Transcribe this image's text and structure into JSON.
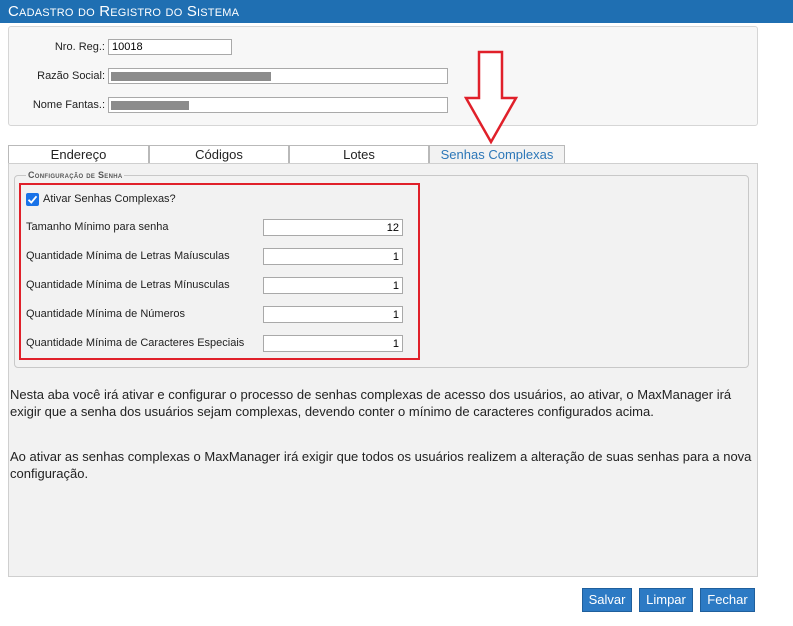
{
  "window": {
    "title": "Cadastro do Registro do Sistema"
  },
  "header": {
    "nro_reg_label": "Nro. Reg.:",
    "nro_reg_value": "10018",
    "razao_social_label": "Razão Social:",
    "nome_fantasia_label": "Nome Fantas.:"
  },
  "tabs": [
    {
      "label": "Endereço"
    },
    {
      "label": "Códigos"
    },
    {
      "label": "Lotes"
    },
    {
      "label": "Senhas Complexas",
      "active": true
    }
  ],
  "config": {
    "legend": "Configuração de Senha",
    "enable_label": "Ativar Senhas Complexas?",
    "enabled": true,
    "fields": [
      {
        "label": "Tamanho Mínimo para senha",
        "value": "12"
      },
      {
        "label": "Quantidade Mínima de Letras Maíusculas",
        "value": "1"
      },
      {
        "label": "Quantidade Mínima de Letras Mínusculas",
        "value": "1"
      },
      {
        "label": "Quantidade Mínima de Números",
        "value": "1"
      },
      {
        "label": "Quantidade Mínima de Caracteres Especiais",
        "value": "1"
      }
    ]
  },
  "info": {
    "paragraph1": "Nesta aba você irá ativar e configurar o processo de senhas complexas de acesso dos usuários, ao ativar, o MaxManager irá exigir que a senha dos usuários sejam complexas, devendo conter o mínimo de caracteres configurados acima.",
    "paragraph2": "Ao ativar as senhas complexas o MaxManager irá exigir que todos os usuários realizem a alteração de suas senhas para a nova configuração."
  },
  "buttons": {
    "salvar": "Salvar",
    "limpar": "Limpar",
    "fechar": "Fechar"
  },
  "colors": {
    "titlebar": "#1f6fb2",
    "button": "#2c7ac4",
    "highlight": "#e0202a",
    "active_tab_text": "#2c77b8",
    "checkbox": "#1a73e8"
  }
}
